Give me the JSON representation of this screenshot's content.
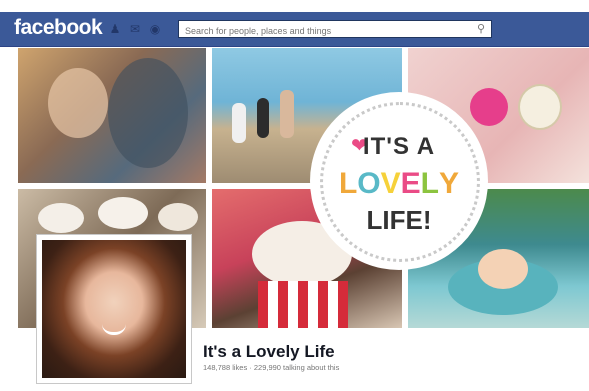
{
  "header": {
    "logo": "facebook",
    "search_placeholder": "Search for people, places and things"
  },
  "cover": {
    "badge": {
      "line1": "IT'S A",
      "line2": [
        "L",
        "O",
        "V",
        "E",
        "L",
        "Y"
      ],
      "line3": "LIFE!"
    },
    "colors": {
      "heart": "#ea4b86",
      "L": "#f0a83a",
      "O": "#59b9c7",
      "V": "#f6d13a",
      "E": "#ea4b86",
      "L2": "#8cc43f",
      "Y": "#f0a83a"
    }
  },
  "page": {
    "title": "It's a Lovely Life",
    "stats": "148,788 likes · 229,990 talking about this"
  },
  "colors": {
    "brand": "#3b5998"
  }
}
